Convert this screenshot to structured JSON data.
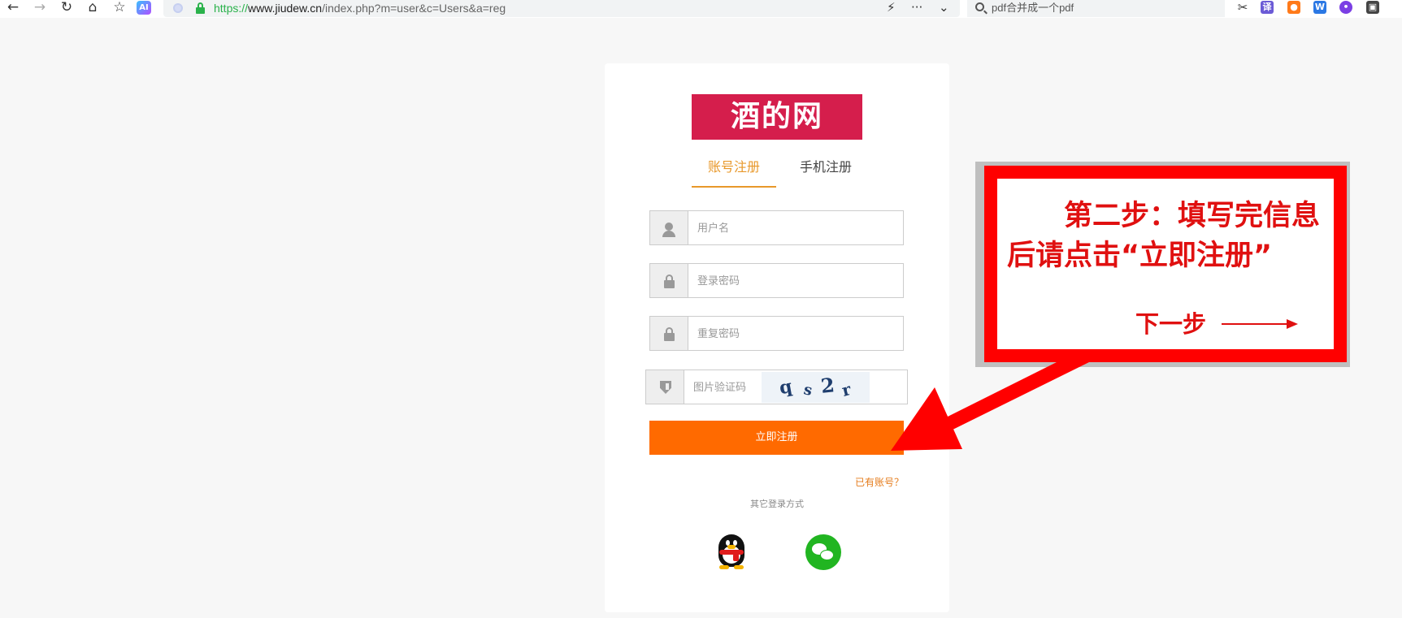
{
  "browser": {
    "url_scheme": "https://",
    "url_host": "www.jiudew.cn",
    "url_path": "/index.php?m=user&c=Users&a=reg",
    "search_text": "pdf合并成一个pdf",
    "ai_badge": "AI",
    "menu_dots": "···"
  },
  "site": {
    "logo_text": "酒的网"
  },
  "tabs": {
    "account": "账号注册",
    "phone": "手机注册"
  },
  "form": {
    "username_placeholder": "用户名",
    "password_placeholder": "登录密码",
    "repeat_password_placeholder": "重复密码",
    "captcha_placeholder": "图片验证码",
    "captcha_chars": [
      "q",
      "s",
      "2",
      "r"
    ],
    "submit_label": "立即注册",
    "has_account_link": "已有账号？",
    "other_login_label": "其它登录方式"
  },
  "annotation": {
    "instruction_text": "第二步：填写完信息后请点击“立即注册”",
    "next_step_text": "下一步",
    "color": "#ff0000"
  },
  "colors": {
    "logo_bg": "#d51e4c",
    "active_tab": "#e8982a",
    "submit_bg": "#ff6a00",
    "wechat_green": "#21b521"
  }
}
